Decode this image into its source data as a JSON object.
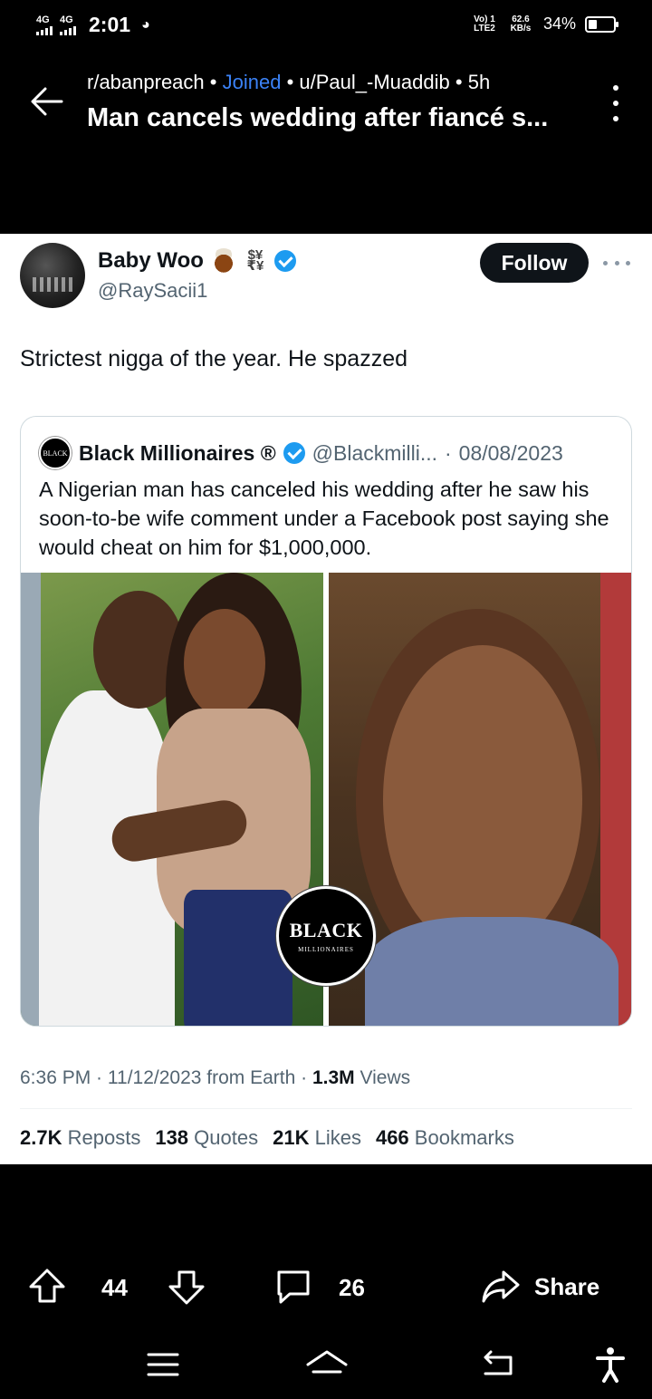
{
  "status_bar": {
    "signal_1": "4G",
    "signal_2": "4G",
    "time": "2:01",
    "volte": "Vo) 1 LTE2",
    "speed": "62.6 KB/s",
    "battery_text": "34%",
    "battery_level": 0.34
  },
  "header": {
    "subreddit": "r/abanpreach",
    "joined": "Joined",
    "author": "u/Paul_-Muaddib",
    "age": "5h",
    "title": "Man cancels wedding after fiancé s..."
  },
  "tweet": {
    "user_name": "Baby Woo",
    "emoji_text": "$¥ ₹¥",
    "handle": "@RaySacii1",
    "follow_label": "Follow",
    "text": "Strictest nigga of the year. He spazzed",
    "time": "6:36 PM",
    "date": "11/12/2023",
    "source": "from Earth",
    "views_count": "1.3M",
    "views_label": "Views",
    "stats": [
      {
        "count": "2.7K",
        "label": "Reposts"
      },
      {
        "count": "138",
        "label": "Quotes"
      },
      {
        "count": "21K",
        "label": "Likes"
      },
      {
        "count": "466",
        "label": "Bookmarks"
      }
    ]
  },
  "quote": {
    "logo_text": "BLACK",
    "name": "Black Millionaires ®",
    "handle": "@Blackmilli...",
    "date": "08/08/2023",
    "text": "A Nigerian man has canceled his wedding after he saw his soon-to-be wife comment under a Facebook post saying she would cheat on him for $1,000,000.",
    "badge_big": "BLACK",
    "badge_small": "MILLIONAIRES"
  },
  "actions": {
    "upvotes": "44",
    "comments": "26",
    "share": "Share"
  },
  "icons": [
    "back-arrow-icon",
    "kebab-menu-icon",
    "verified-icon",
    "more-icon",
    "upvote-icon",
    "downvote-icon",
    "comment-icon",
    "share-icon",
    "menu-icon",
    "home-icon",
    "back-icon",
    "accessibility-icon"
  ]
}
